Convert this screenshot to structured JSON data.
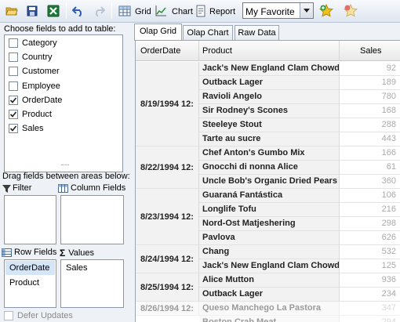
{
  "toolbar": {
    "grid_label": "Grid",
    "chart_label": "Chart",
    "report_label": "Report",
    "favorite_value": "My Favorite"
  },
  "fields": {
    "title": "Choose fields to add to table:",
    "items": [
      {
        "label": "Category",
        "checked": false
      },
      {
        "label": "Country",
        "checked": false
      },
      {
        "label": "Customer",
        "checked": false
      },
      {
        "label": "Employee",
        "checked": false
      },
      {
        "label": "OrderDate",
        "checked": true
      },
      {
        "label": "Product",
        "checked": true
      },
      {
        "label": "Sales",
        "checked": true
      }
    ]
  },
  "areas": {
    "drag_title": "Drag fields between areas below:",
    "filter_label": "Filter",
    "column_fields_label": "Column Fields",
    "row_fields_label": "Row Fields",
    "values_label": "Values",
    "row_fields": [
      "OrderDate",
      "Product"
    ],
    "values": [
      "Sales"
    ],
    "defer_label": "Defer Updates"
  },
  "tabs": [
    "Olap Grid",
    "Olap Chart",
    "Raw Data"
  ],
  "grid": {
    "headers": {
      "orderdate": "OrderDate",
      "product": "Product",
      "sales": "Sales"
    },
    "groups": [
      {
        "date": "8/19/1994 12:",
        "rows": [
          {
            "product": "Jack's New England Clam Chowder",
            "value": "92"
          },
          {
            "product": "Outback Lager",
            "value": "189"
          },
          {
            "product": "Ravioli Angelo",
            "value": "780"
          },
          {
            "product": "Sir Rodney's Scones",
            "value": "168"
          },
          {
            "product": "Steeleye Stout",
            "value": "288"
          },
          {
            "product": "Tarte au sucre",
            "value": "443"
          }
        ]
      },
      {
        "date": "8/22/1994 12:",
        "rows": [
          {
            "product": "Chef Anton's Gumbo Mix",
            "value": "166"
          },
          {
            "product": "Gnocchi di nonna Alice",
            "value": "61"
          },
          {
            "product": "Uncle Bob's Organic Dried Pears",
            "value": "360"
          }
        ]
      },
      {
        "date": "8/23/1994 12:",
        "rows": [
          {
            "product": "Guaraná Fantástica",
            "value": "106"
          },
          {
            "product": "Longlife Tofu",
            "value": "216"
          },
          {
            "product": "Nord-Ost Matjeshering",
            "value": "298"
          },
          {
            "product": "Pavlova",
            "value": "626"
          }
        ]
      },
      {
        "date": "8/24/1994 12:",
        "rows": [
          {
            "product": "Chang",
            "value": "532"
          },
          {
            "product": "Jack's New England Clam Chowder",
            "value": "125"
          }
        ]
      },
      {
        "date": "8/25/1994 12:",
        "rows": [
          {
            "product": "Alice Mutton",
            "value": "936"
          },
          {
            "product": "Outback Lager",
            "value": "234"
          }
        ]
      },
      {
        "date": "8/26/1994 12:",
        "rows": [
          {
            "product": "Queso Manchego La Pastora",
            "value": "347"
          },
          {
            "product": "Boston Crab Meat",
            "value": "294"
          }
        ]
      }
    ]
  }
}
